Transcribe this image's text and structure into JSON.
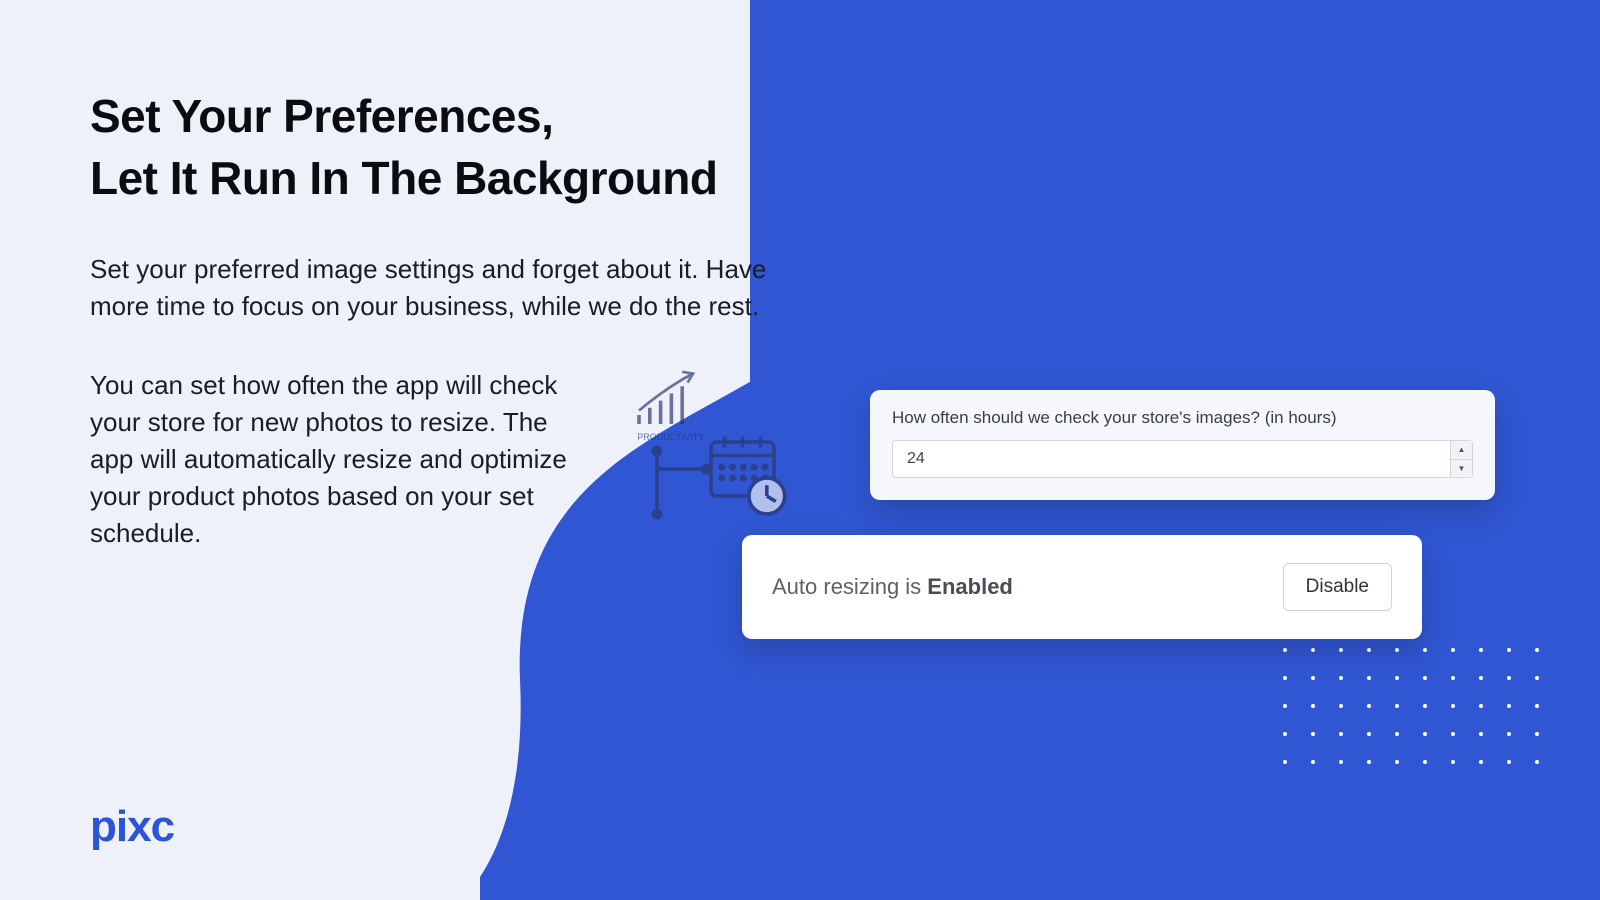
{
  "heading_line1": "Set Your Preferences,",
  "heading_line2": "Let It Run In The Background",
  "para1": "Set your preferred image settings and forget about it. Have more time to focus on your business, while we do the rest.",
  "para2": "You can set how often the app will check your store for new photos to resize. The app will automatically resize and optimize your product photos based on your set schedule.",
  "logo": "pixc",
  "card1": {
    "label": "How often should we check your store's images? (in hours)",
    "value": "24"
  },
  "card2": {
    "text_prefix": "Auto resizing is ",
    "text_status": "Enabled",
    "button": "Disable"
  },
  "icon_label": "PRODUCTIVITY",
  "colors": {
    "accent": "#3056d3",
    "panel_bg": "#eef1f9"
  }
}
